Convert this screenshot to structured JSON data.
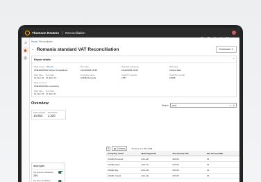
{
  "topbar": {
    "brand": "Thomson Reuters",
    "app_name": "Reconciliation"
  },
  "breadcrumb": {
    "home": "Home",
    "current": "Reconciliation"
  },
  "page": {
    "title": "Romania standard VAT Reconciliation",
    "download_label": "Download"
  },
  "report_details": {
    "heading": "Report details",
    "fields": [
      {
        "label": "Data source 1",
        "badge": "Primary",
        "value": "ONESOURCE Indirect Compliance"
      },
      {
        "label": "Run date",
        "value": "11/12/2023 15:39"
      },
      {
        "label": "Data last refreshed",
        "value": "11/12/2024 16:29"
      },
      {
        "label": "Date type",
        "value": "Invoice date"
      },
      {
        "label": "Start date",
        "value": "11-Dec-24",
        "label2": "End date",
        "value2": "31-Dec-24"
      },
      {
        "label": "Company name",
        "value": "ACME Romania"
      },
      {
        "label": "Total ITC records",
        "value": "1537"
      },
      {
        "label": "Total ITC records",
        "value": "10095"
      },
      {
        "label": "Data source 2",
        "value": "ONESOURCE e-Invoicing"
      },
      {
        "label": "Start date",
        "value": "11-Dec-24",
        "label2": "End date",
        "value2": "31-Dec-24"
      }
    ]
  },
  "overview": {
    "heading": "Overview",
    "search_label": "Search",
    "search_value": "xxxx",
    "totals": [
      {
        "label": "Total matched",
        "value": "10,653"
      },
      {
        "label": "Total issues",
        "value": "1,320"
      }
    ],
    "columns_label": "Columns",
    "showing": "Showing 1 to 25 of 998"
  },
  "filters": {
    "heading": "Issue types",
    "items": [
      {
        "label": "Tax amount mismatches",
        "value": "250"
      },
      {
        "label": "Tax rate mismatches",
        "value": ""
      }
    ]
  },
  "table": {
    "headers": [
      "Company name",
      "Matching field",
      "Tax amount OIC",
      "Tax amount OEI"
    ],
    "rows": [
      [
        "ACME Romania",
        "E11-AB",
        "200.00",
        "16"
      ],
      [
        "ACME Spain",
        "E21-AC",
        "200.00",
        "16"
      ],
      [
        "ACME Italy",
        "E31-AD",
        "200.00",
        "16"
      ],
      [
        "ACME Ireland",
        "E41-AE",
        "200.00",
        "16"
      ]
    ]
  }
}
